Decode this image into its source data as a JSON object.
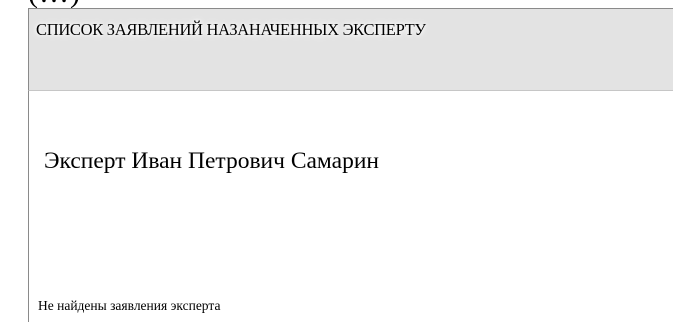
{
  "page": {
    "top_fragment": "(…)",
    "title": "СПИСОК ЗАЯВЛЕНИЙ НАЗАНАЧЕННЫХ ЭКСПЕРТУ"
  },
  "expert": {
    "heading": "Эксперт Иван Петрович Самарин"
  },
  "applications": {
    "empty_message": "Не найдены заявления эксперта"
  }
}
